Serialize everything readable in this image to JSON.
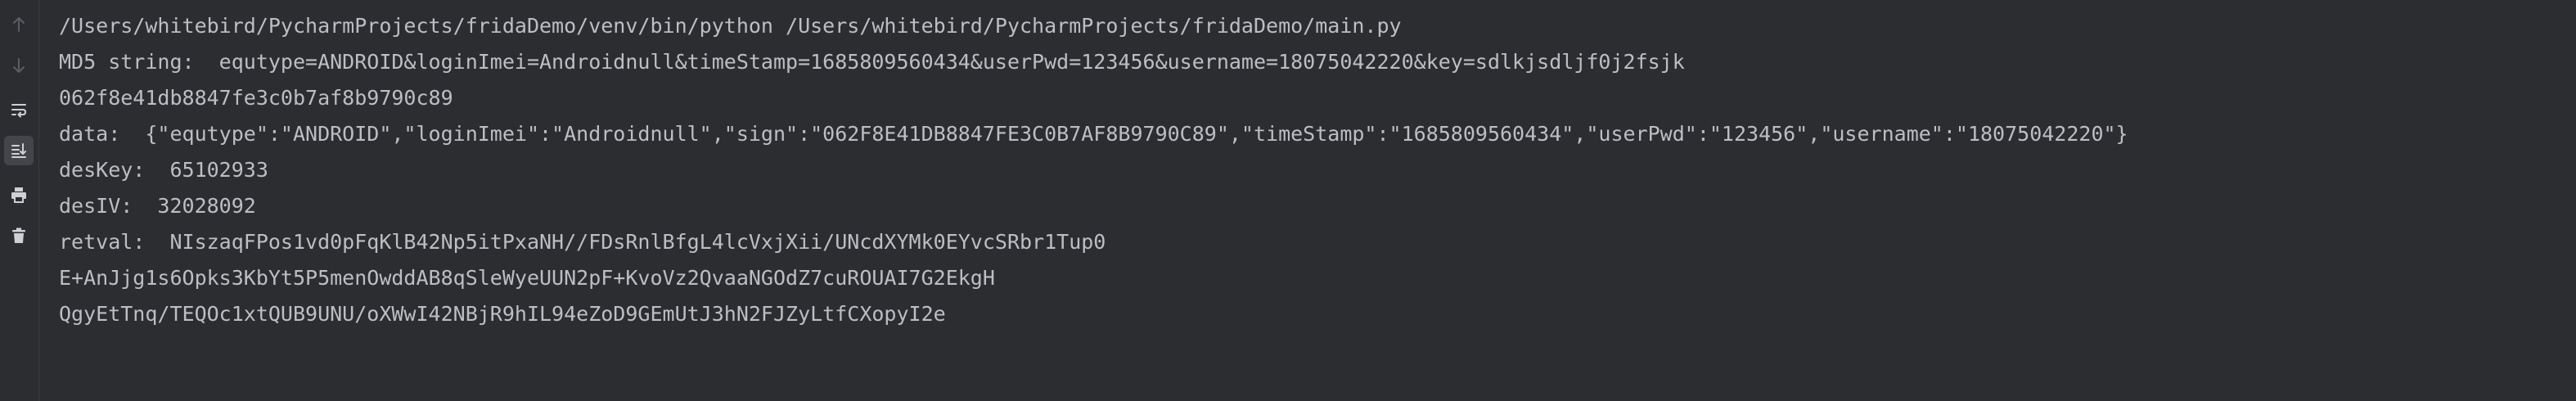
{
  "toolbar": {
    "buttons": [
      {
        "icon": "arrow-up-icon",
        "enabled": false
      },
      {
        "icon": "arrow-down-icon",
        "enabled": false
      },
      {
        "icon": "soft-wrap-icon",
        "enabled": true
      },
      {
        "icon": "scroll-to-end-icon",
        "enabled": true,
        "active": true
      },
      {
        "icon": "print-icon",
        "enabled": true
      },
      {
        "icon": "trash-icon",
        "enabled": true
      }
    ]
  },
  "console": {
    "lines": [
      "/Users/whitebird/PycharmProjects/fridaDemo/venv/bin/python /Users/whitebird/PycharmProjects/fridaDemo/main.py",
      "MD5 string:  equtype=ANDROID&loginImei=Androidnull&timeStamp=1685809560434&userPwd=123456&username=18075042220&key=sdlkjsdljf0j2fsjk",
      "062f8e41db8847fe3c0b7af8b9790c89",
      "data:  {\"equtype\":\"ANDROID\",\"loginImei\":\"Androidnull\",\"sign\":\"062F8E41DB8847FE3C0B7AF8B9790C89\",\"timeStamp\":\"1685809560434\",\"userPwd\":\"123456\",\"username\":\"18075042220\"}",
      "desKey:  65102933",
      "desIV:  32028092",
      "retval:  NIszaqFPos1vd0pFqKlB42Np5itPxaNH//FDsRnlBfgL4lcVxjXii/UNcdXYMk0EYvcSRbr1Tup0",
      "E+AnJjg1s6Opks3KbYt5P5menOwddAB8qSleWyeUUN2pF+KvoVz2QvaaNGOdZ7cuROUAI7G2EkgH",
      "QgyEtTnq/TEQOc1xtQUB9UNU/oXWwI42NBjR9hIL94eZoD9GEmUtJ3hN2FJZyLtfCXopyI2e"
    ]
  },
  "colors": {
    "background": "#2b2d30",
    "text": "#bcbec4",
    "icon_enabled": "#ced0d6",
    "icon_disabled": "#5a5d63"
  }
}
